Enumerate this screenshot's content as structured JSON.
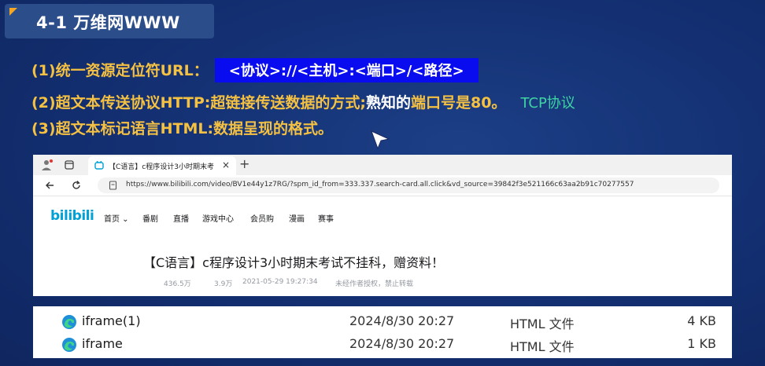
{
  "slide": {
    "title": "4-1 万维网WWW",
    "line1": {
      "prefix": "(1)统一资源定位符URL：",
      "url_format": "<协议>://<主机>:<端口>/<路径>"
    },
    "line2": {
      "part1": "(2)超文本传送协议HTTP:超链接传送数据的方式;",
      "part2": "熟知的",
      "part3": "端口号是80。",
      "note": "TCP协议"
    },
    "line3": {
      "text": "(3)超文本标记语言HTML:数据呈现的格式。"
    }
  },
  "browser": {
    "tab_title": "【C语言】c程序设计3小时期末考",
    "tab_close": "×",
    "new_tab": "+",
    "url": "https://www.bilibili.com/video/BV1e44y1z7RG/?spm_id_from=333.337.search-card.all.click&vd_source=39842f3e521166c63aa2b91c70277557",
    "logo": "bilibili",
    "nav": [
      "首页 ⌄",
      "番剧",
      "直播",
      "游戏中心",
      "会员购",
      "漫画",
      "赛事"
    ],
    "video_title": "【C语言】c程序设计3小时期末考试不挂科，赠资料！",
    "views": "436.5万",
    "danmaku": "3.9万",
    "date": "2021-05-29 19:27:34",
    "notice": "未经作者授权，禁止转载"
  },
  "files": [
    {
      "name": "iframe(1)",
      "date": "2024/8/30 20:27",
      "type": "HTML 文件",
      "size": "4 KB"
    },
    {
      "name": "iframe",
      "date": "2024/8/30 20:27",
      "type": "HTML 文件",
      "size": "1 KB"
    }
  ],
  "colors": {
    "slide_bg": "#143174",
    "gold_text": "#f5c142",
    "url_highlight": "#0a0cf0",
    "tcp_note": "#3fd3a4",
    "bilibili_blue": "#00a1d6"
  }
}
